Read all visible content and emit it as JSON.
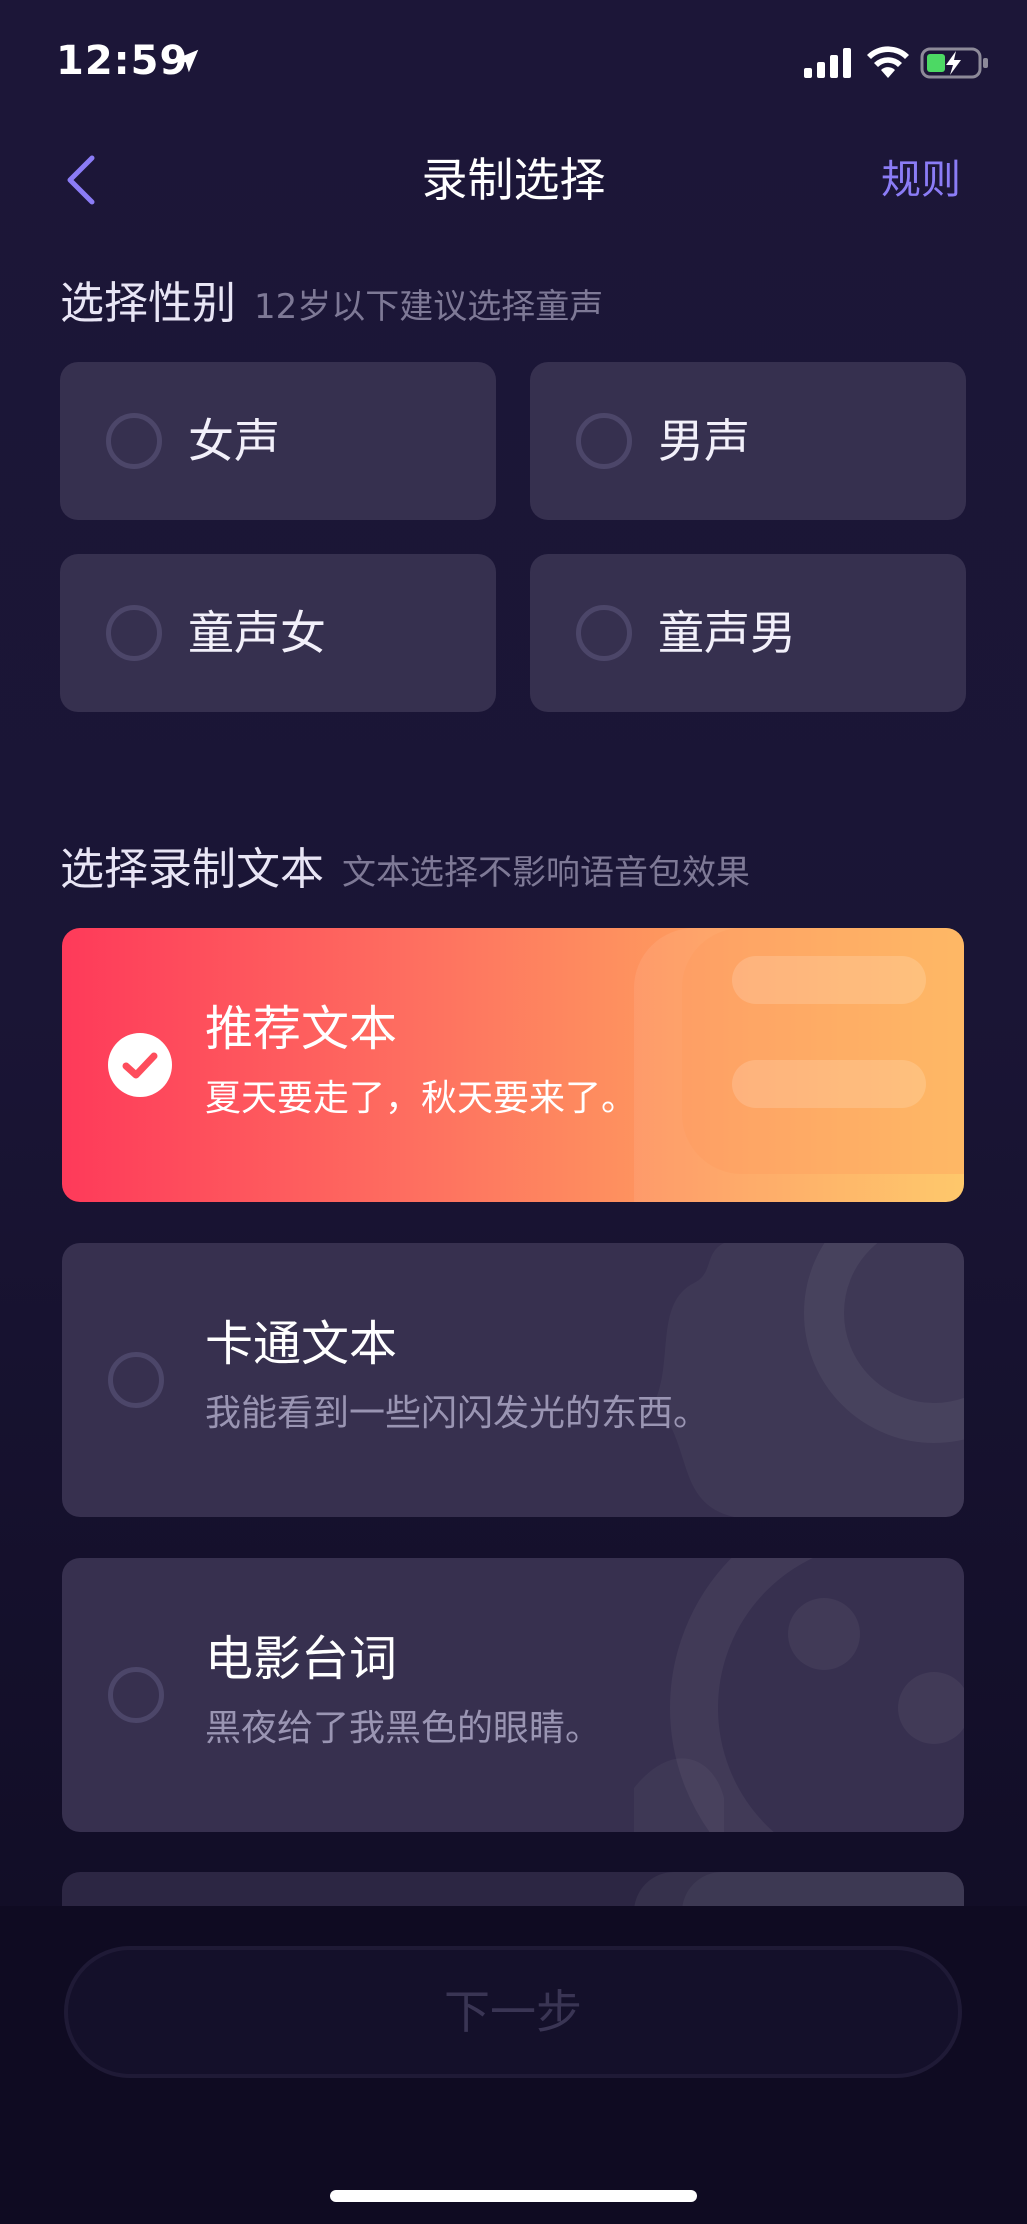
{
  "status_bar": {
    "time": "12:59"
  },
  "nav": {
    "title": "录制选择",
    "rules": "规则"
  },
  "gender_section": {
    "label": "选择性别",
    "hint": "12岁以下建议选择童声",
    "options": [
      "女声",
      "男声",
      "童声女",
      "童声男"
    ]
  },
  "text_section": {
    "label": "选择录制文本",
    "hint": "文本选择不影响语音包效果",
    "options": [
      {
        "title": "推荐文本",
        "sample": "夏天要走了，秋天要来了。",
        "selected": true
      },
      {
        "title": "卡通文本",
        "sample": "我能看到一些闪闪发光的东西。",
        "selected": false
      },
      {
        "title": "电影台词",
        "sample": "黑夜给了我黑色的眼睛。",
        "selected": false
      }
    ]
  },
  "footer": {
    "next_label": "下一步"
  },
  "colors": {
    "accent": "#8b7cf6",
    "selected_gradient_start": "#fe3a5a",
    "selected_gradient_end": "#fec45f"
  }
}
